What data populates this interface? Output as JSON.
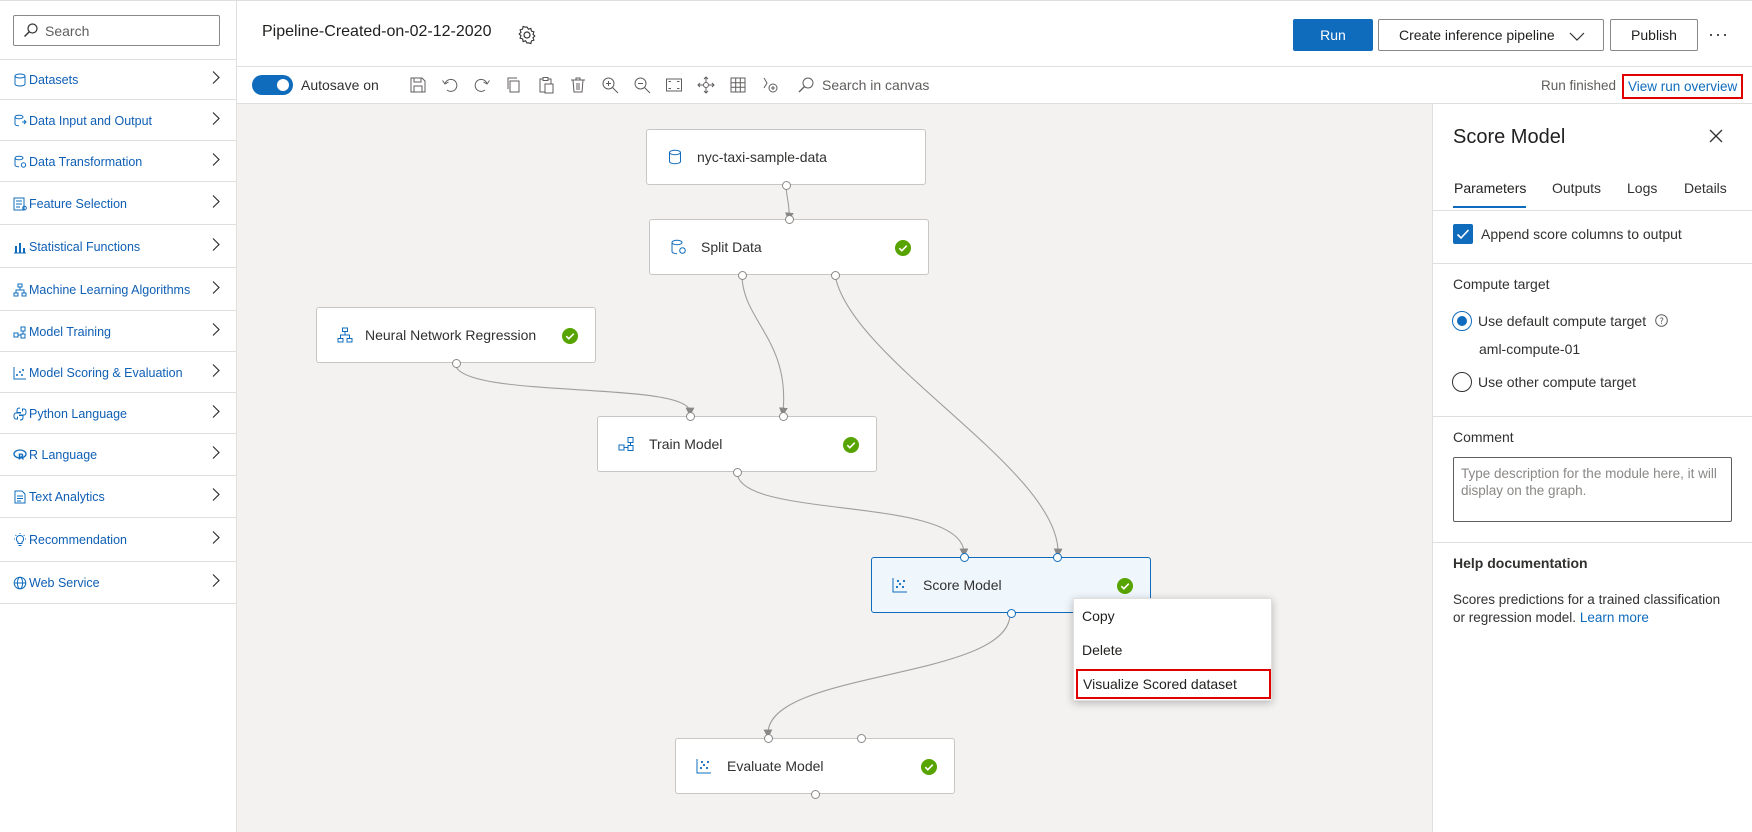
{
  "sidebar": {
    "search_placeholder": "Search",
    "items": [
      {
        "label": "Datasets",
        "icon": "cylinder-icon"
      },
      {
        "label": "Data Input and Output",
        "icon": "data-io-icon"
      },
      {
        "label": "Data Transformation",
        "icon": "data-transform-icon"
      },
      {
        "label": "Feature Selection",
        "icon": "feature-selection-icon"
      },
      {
        "label": "Statistical Functions",
        "icon": "bar-chart-icon"
      },
      {
        "label": "Machine Learning Algorithms",
        "icon": "network-icon"
      },
      {
        "label": "Model Training",
        "icon": "model-training-icon"
      },
      {
        "label": "Model Scoring & Evaluation",
        "icon": "scatter-icon"
      },
      {
        "label": "Python Language",
        "icon": "python-icon"
      },
      {
        "label": "R Language",
        "icon": "r-icon"
      },
      {
        "label": "Text Analytics",
        "icon": "document-icon"
      },
      {
        "label": "Recommendation",
        "icon": "lightbulb-icon"
      },
      {
        "label": "Web Service",
        "icon": "globe-icon"
      }
    ]
  },
  "header": {
    "title": "Pipeline-Created-on-02-12-2020",
    "run_label": "Run",
    "inference_label": "Create inference pipeline",
    "publish_label": "Publish",
    "more_label": "···"
  },
  "toolbar": {
    "autosave_label": "Autosave on",
    "canvas_search_placeholder": "Search in canvas",
    "run_status": "Run finished",
    "view_run_link": "View run overview"
  },
  "canvas": {
    "nodes": {
      "dataset": "nyc-taxi-sample-data",
      "split": "Split Data",
      "nn": "Neural Network Regression",
      "train": "Train Model",
      "score": "Score Model",
      "evaluate": "Evaluate Model"
    },
    "context_menu": {
      "copy": "Copy",
      "delete": "Delete",
      "visualize": "Visualize Scored dataset"
    }
  },
  "panel": {
    "title": "Score Model",
    "tabs": [
      "Parameters",
      "Outputs",
      "Logs",
      "Details"
    ],
    "append_label": "Append score columns to output",
    "compute_heading": "Compute target",
    "default_compute_label": "Use default compute target",
    "compute_name": "aml-compute-01",
    "other_compute_label": "Use other compute target",
    "comment_heading": "Comment",
    "comment_placeholder": "Type description for the module here, it will display on the graph.",
    "help_heading": "Help documentation",
    "help_text": "Scores predictions for a trained classification or regression model.",
    "learn_more": "Learn more"
  },
  "colors": {
    "accent": "#0f6cbd",
    "success": "#57a300",
    "highlight": "#e00000"
  }
}
